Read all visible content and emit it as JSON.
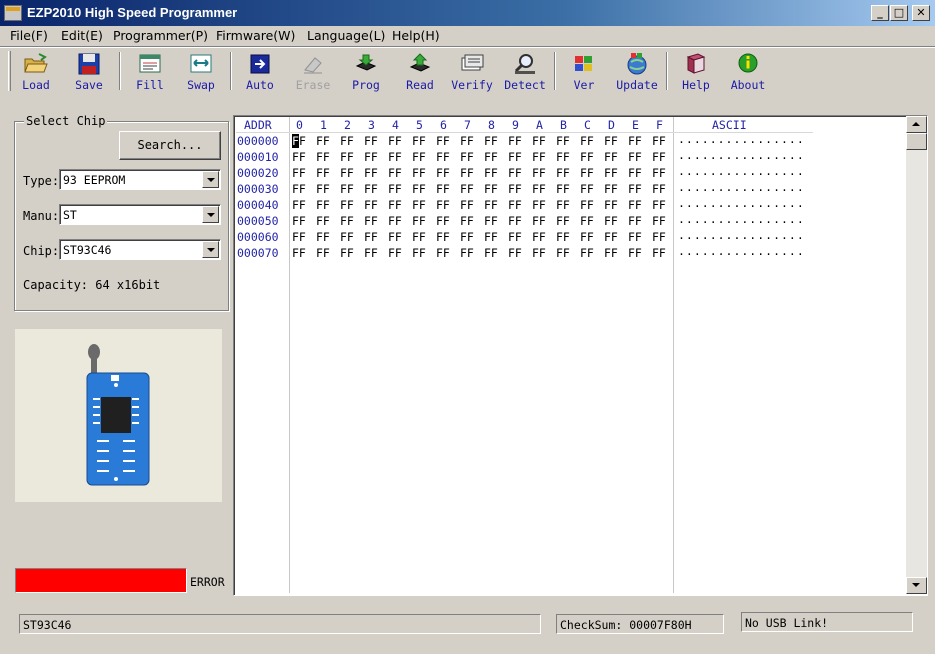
{
  "window": {
    "title": "EZP2010 High Speed Programmer",
    "min": "_",
    "max": "□",
    "close": "✕"
  },
  "menu": [
    "File(F)",
    "Edit(E)",
    "Programmer(P)",
    "Firmware(W)",
    "Language(L)",
    "Help(H)"
  ],
  "toolbar": [
    {
      "label": "Load",
      "icon": "folder-open-icon",
      "enabled": true
    },
    {
      "label": "Save",
      "icon": "floppy-disk-icon",
      "enabled": true
    },
    {
      "label": "Fill",
      "icon": "fill-icon",
      "enabled": true
    },
    {
      "label": "Swap",
      "icon": "swap-icon",
      "enabled": true
    },
    {
      "label": "Auto",
      "icon": "auto-icon",
      "enabled": true
    },
    {
      "label": "Erase",
      "icon": "eraser-icon",
      "enabled": false
    },
    {
      "label": "Prog",
      "icon": "program-chip-icon",
      "enabled": true
    },
    {
      "label": "Read",
      "icon": "read-chip-icon",
      "enabled": true
    },
    {
      "label": "Verify",
      "icon": "verify-icon",
      "enabled": true
    },
    {
      "label": "Detect",
      "icon": "magnifier-icon",
      "enabled": true
    },
    {
      "label": "Ver",
      "icon": "version-icon",
      "enabled": true
    },
    {
      "label": "Update",
      "icon": "globe-update-icon",
      "enabled": true
    },
    {
      "label": "Help",
      "icon": "help-book-icon",
      "enabled": true
    },
    {
      "label": "About",
      "icon": "info-icon",
      "enabled": true
    }
  ],
  "chip_panel": {
    "title": "Select Chip",
    "search_label": "Search...",
    "type_label": "Type:",
    "type_value": "93 EEPROM",
    "manu_label": "Manu:",
    "manu_value": "ST",
    "chip_label": "Chip:",
    "chip_value": "ST93C46",
    "capacity": "Capacity: 64 x16bit"
  },
  "error_indicator": {
    "color": "#ff0000",
    "label": "ERROR"
  },
  "hex": {
    "addr_header": "ADDR",
    "columns": [
      "0",
      "1",
      "2",
      "3",
      "4",
      "5",
      "6",
      "7",
      "8",
      "9",
      "A",
      "B",
      "C",
      "D",
      "E",
      "F"
    ],
    "ascii_header": "ASCII",
    "rows": [
      {
        "addr": "000000",
        "bytes": [
          "FF",
          "FF",
          "FF",
          "FF",
          "FF",
          "FF",
          "FF",
          "FF",
          "FF",
          "FF",
          "FF",
          "FF",
          "FF",
          "FF",
          "FF",
          "FF"
        ],
        "ascii": "................"
      },
      {
        "addr": "000010",
        "bytes": [
          "FF",
          "FF",
          "FF",
          "FF",
          "FF",
          "FF",
          "FF",
          "FF",
          "FF",
          "FF",
          "FF",
          "FF",
          "FF",
          "FF",
          "FF",
          "FF"
        ],
        "ascii": "................"
      },
      {
        "addr": "000020",
        "bytes": [
          "FF",
          "FF",
          "FF",
          "FF",
          "FF",
          "FF",
          "FF",
          "FF",
          "FF",
          "FF",
          "FF",
          "FF",
          "FF",
          "FF",
          "FF",
          "FF"
        ],
        "ascii": "................"
      },
      {
        "addr": "000030",
        "bytes": [
          "FF",
          "FF",
          "FF",
          "FF",
          "FF",
          "FF",
          "FF",
          "FF",
          "FF",
          "FF",
          "FF",
          "FF",
          "FF",
          "FF",
          "FF",
          "FF"
        ],
        "ascii": "................"
      },
      {
        "addr": "000040",
        "bytes": [
          "FF",
          "FF",
          "FF",
          "FF",
          "FF",
          "FF",
          "FF",
          "FF",
          "FF",
          "FF",
          "FF",
          "FF",
          "FF",
          "FF",
          "FF",
          "FF"
        ],
        "ascii": "................"
      },
      {
        "addr": "000050",
        "bytes": [
          "FF",
          "FF",
          "FF",
          "FF",
          "FF",
          "FF",
          "FF",
          "FF",
          "FF",
          "FF",
          "FF",
          "FF",
          "FF",
          "FF",
          "FF",
          "FF"
        ],
        "ascii": "................"
      },
      {
        "addr": "000060",
        "bytes": [
          "FF",
          "FF",
          "FF",
          "FF",
          "FF",
          "FF",
          "FF",
          "FF",
          "FF",
          "FF",
          "FF",
          "FF",
          "FF",
          "FF",
          "FF",
          "FF"
        ],
        "ascii": "................"
      },
      {
        "addr": "000070",
        "bytes": [
          "FF",
          "FF",
          "FF",
          "FF",
          "FF",
          "FF",
          "FF",
          "FF",
          "FF",
          "FF",
          "FF",
          "FF",
          "FF",
          "FF",
          "FF",
          "FF"
        ],
        "ascii": "................"
      }
    ]
  },
  "status": {
    "chip": "ST93C46",
    "checksum": "CheckSum: 00007F80H",
    "usb": "No USB Link!"
  },
  "colors": {
    "header_blue": "#2323a8",
    "title_gradient_start": "#0a246a",
    "error": "#ff0000"
  }
}
